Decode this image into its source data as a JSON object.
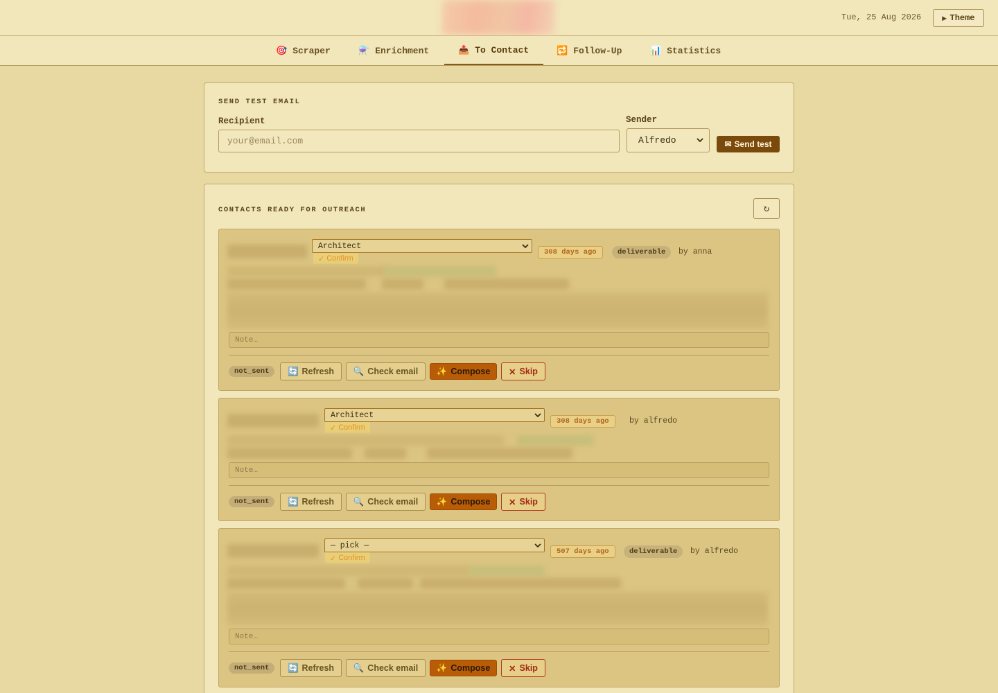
{
  "header": {
    "date": "Tue, 25 Aug 2026",
    "theme_label": "Theme",
    "theme_icon": "▸"
  },
  "tabs": [
    {
      "label": "Scraper",
      "icon": "🎯",
      "icon_name": "target-icon"
    },
    {
      "label": "Enrichment",
      "icon": "⚗️",
      "icon_name": "flask-icon"
    },
    {
      "label": "To Contact",
      "icon": "📤",
      "icon_name": "outbox-icon",
      "active": true
    },
    {
      "label": "Follow-Up",
      "icon": "🔁",
      "icon_name": "repeat-icon"
    },
    {
      "label": "Statistics",
      "icon": "📊",
      "icon_name": "bar-chart-icon"
    }
  ],
  "test_email": {
    "title": "SEND TEST EMAIL",
    "recipient_label": "Recipient",
    "recipient_placeholder": "your@email.com",
    "recipient_value": "",
    "sender_label": "Sender",
    "sender_value": "Alfredo",
    "send_label": "Send test",
    "send_icon": "✉"
  },
  "contacts": {
    "title": "CONTACTS READY FOR OUTREACH",
    "refresh_icon": "↻",
    "confirm_label": "Confirm",
    "confirm_icon": "✓",
    "note_placeholder": "Note…",
    "actions": {
      "refresh": "Refresh",
      "refresh_icon": "🔄",
      "check_email": "Check email",
      "check_icon": "🔍",
      "compose": "Compose",
      "compose_icon": "✨",
      "skip": "Skip",
      "skip_icon": "✕"
    },
    "items": [
      {
        "role": "Architect",
        "age": "308 days ago",
        "verification": "deliverable",
        "by": "by anna",
        "status": "not_sent"
      },
      {
        "role": "Architect",
        "age": "308 days ago",
        "verification": "",
        "by": "by alfredo",
        "status": "not_sent"
      },
      {
        "role": "— pick —",
        "age": "507 days ago",
        "verification": "deliverable",
        "by": "by alfredo",
        "status": "not_sent"
      }
    ]
  }
}
